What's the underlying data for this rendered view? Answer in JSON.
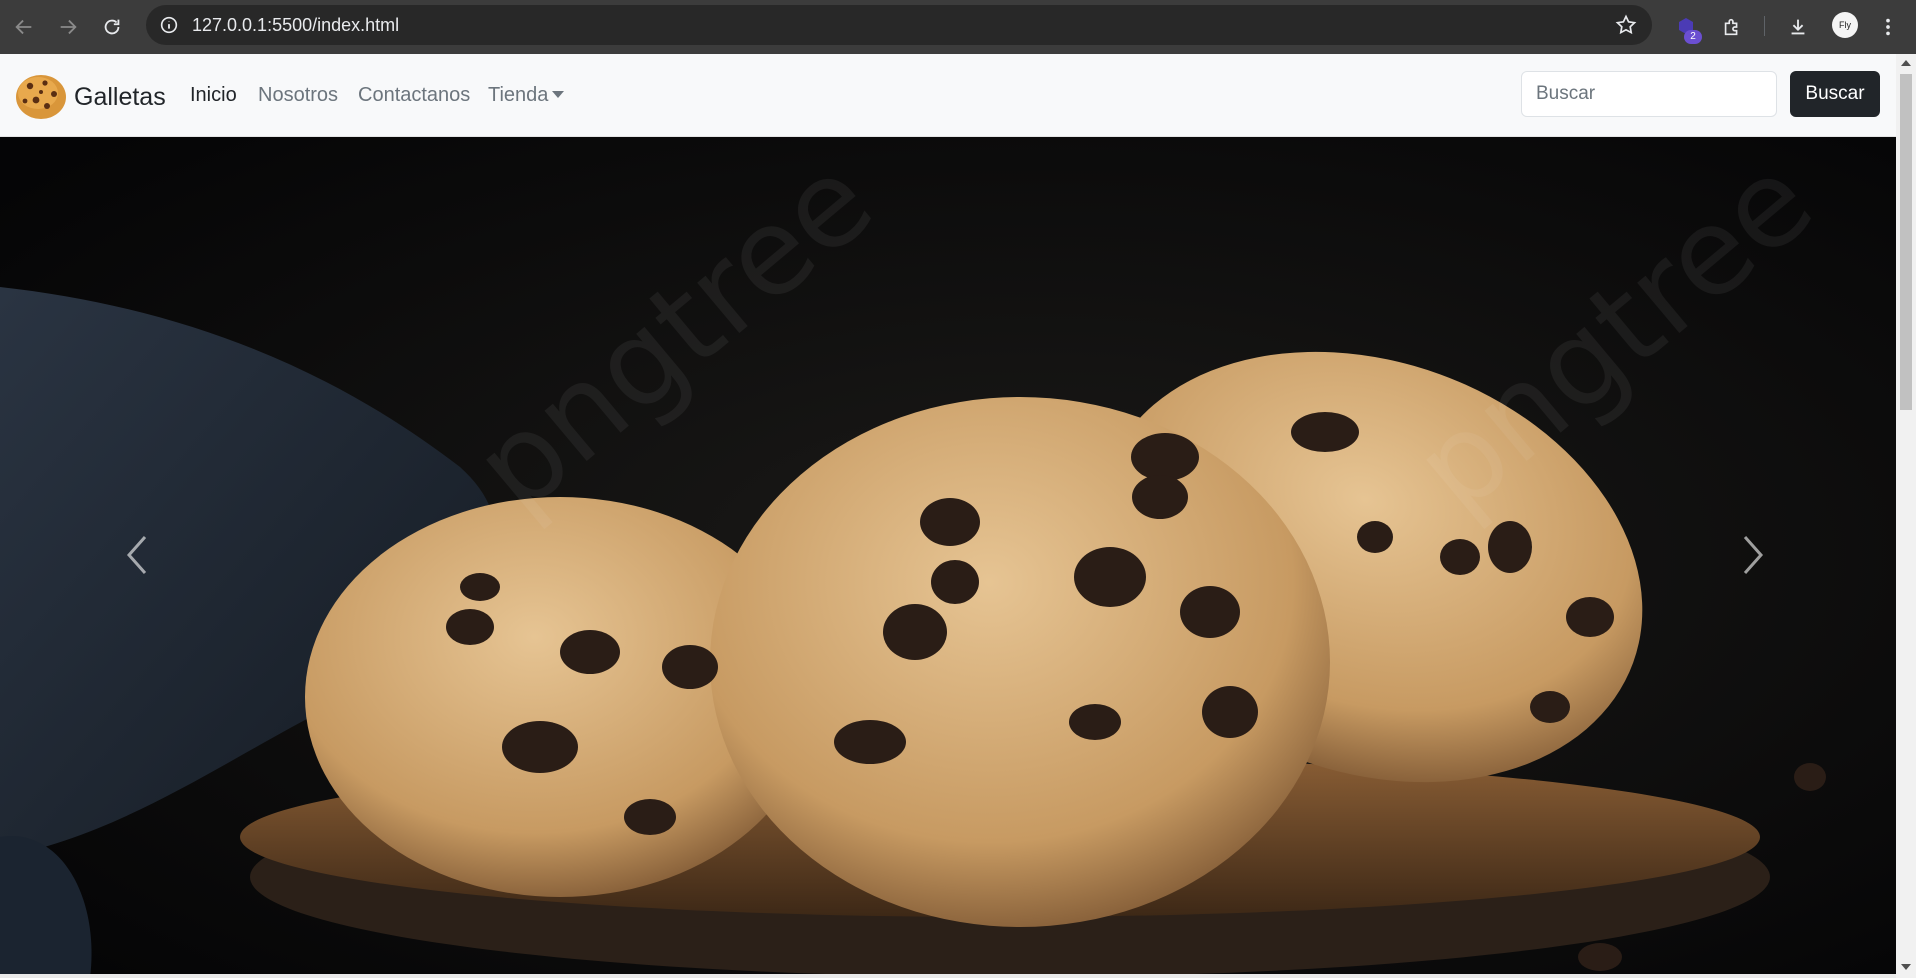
{
  "browser": {
    "url": "127.0.0.1:5500/index.html",
    "extension_badge": "2",
    "profile_label": "Fly",
    "icons": [
      "back-icon",
      "forward-icon",
      "reload-icon",
      "site-info-icon",
      "bookmark-star-icon",
      "extension-icon",
      "puzzle-icon",
      "download-icon",
      "profile-avatar",
      "menu-dots-icon"
    ]
  },
  "navbar": {
    "brand": "Galletas",
    "brand_icon": "cookie-icon",
    "links": [
      {
        "label": "Inicio",
        "active": true
      },
      {
        "label": "Nosotros",
        "active": false
      },
      {
        "label": "Contactanos",
        "active": false
      },
      {
        "label": "Tienda",
        "active": false,
        "dropdown": true
      }
    ],
    "search_placeholder": "Buscar",
    "search_button": "Buscar"
  },
  "carousel": {
    "image_alt": "",
    "prev_icon": "chevron-left-icon",
    "next_icon": "chevron-right-icon",
    "watermark": "pngtree"
  },
  "colors": {
    "navbar_bg": "#f8f9fa",
    "button_dark": "#212529",
    "chrome_bg": "#3c3c3c"
  }
}
